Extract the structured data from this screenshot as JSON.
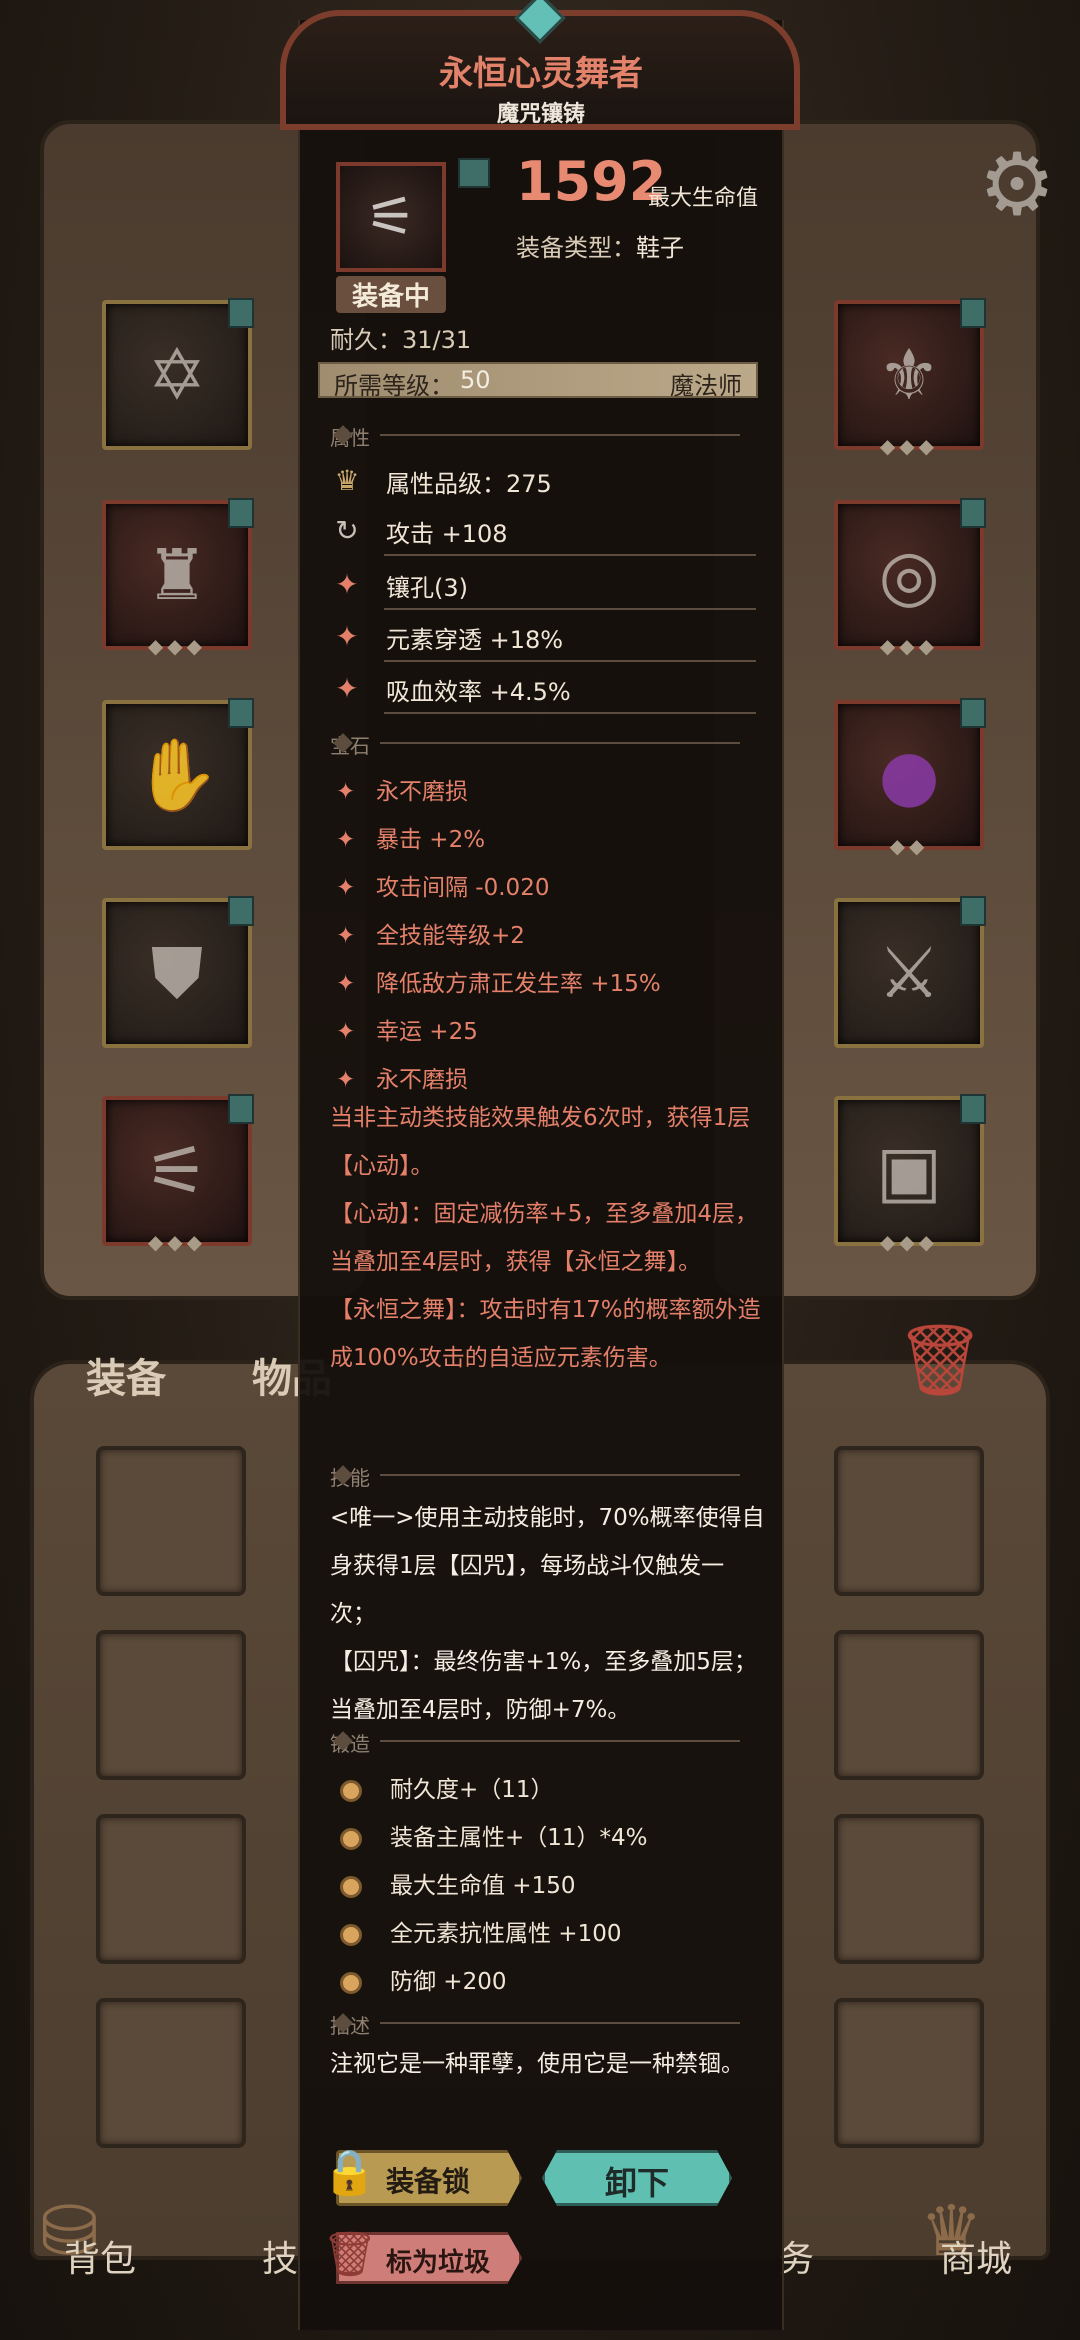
{
  "item": {
    "name": "永恒心灵舞者",
    "subtitle": "魔咒镶铸",
    "equipped_label": "装备中",
    "durability_label": "耐久：",
    "durability_value": "31/31",
    "hp_value": "1592",
    "hp_label": "最大生命值",
    "type_label": "装备类型：",
    "type_value": "鞋子",
    "required_level_label": "所需等级：",
    "required_level_value": "50",
    "class": "魔法师"
  },
  "sections": {
    "attributes": "属性",
    "gems": "宝石",
    "skill": "技能",
    "forge": "锻造",
    "description": "描述"
  },
  "attributes": [
    {
      "icon": "attribute-grade-icon",
      "text": "属性品级：275"
    },
    {
      "icon": "attack-icon",
      "text": "攻击 +108"
    },
    {
      "icon": "socket-icon",
      "text": "镶孔(3)"
    },
    {
      "icon": "element-icon",
      "text": "元素穿透 +18%"
    },
    {
      "icon": "lifesteal-icon",
      "text": "吸血效率 +4.5%"
    }
  ],
  "gems": [
    "永不磨损",
    "暴击 +2%",
    "攻击间隔 -0.020",
    "全技能等级+2",
    "降低敌方肃正发生率 +15%",
    "幸运 +25",
    "永不磨损"
  ],
  "effect_lines": [
    "当非主动类技能效果触发6次时，获得1层【心动】。",
    "【心动】：固定减伤率+5，至多叠加4层，当叠加至4层时，获得【永恒之舞】。",
    "【永恒之舞】：攻击时有17%的概率额外造成100%攻击的自适应元素伤害。"
  ],
  "skill_lines": [
    "<唯一>使用主动技能时，70%概率使得自身获得1层【囚咒】，每场战斗仅触发一次；",
    "【囚咒】：最终伤害+1%，至多叠加5层；当叠加至4层时，防御+7%。"
  ],
  "forge": [
    "耐久度+（11）",
    "装备主属性+（11）*4%",
    "最大生命值 +150",
    "全元素抗性属性 +100",
    "防御 +200"
  ],
  "description": "注视它是一种罪孽，使用它是一种禁锢。",
  "buttons": {
    "lock": "装备锁",
    "unequip": "卸下",
    "mark_trash": "标为垃圾"
  },
  "bag_tabs": {
    "equipment": "装备",
    "items": "物品"
  },
  "nav": {
    "bag": "背包",
    "skills": "技",
    "tasks": "务",
    "shop": "商城"
  },
  "colors": {
    "name": "#e3826a",
    "effect_text": "#e4806a",
    "accent_teal": "#5fc0b2"
  }
}
